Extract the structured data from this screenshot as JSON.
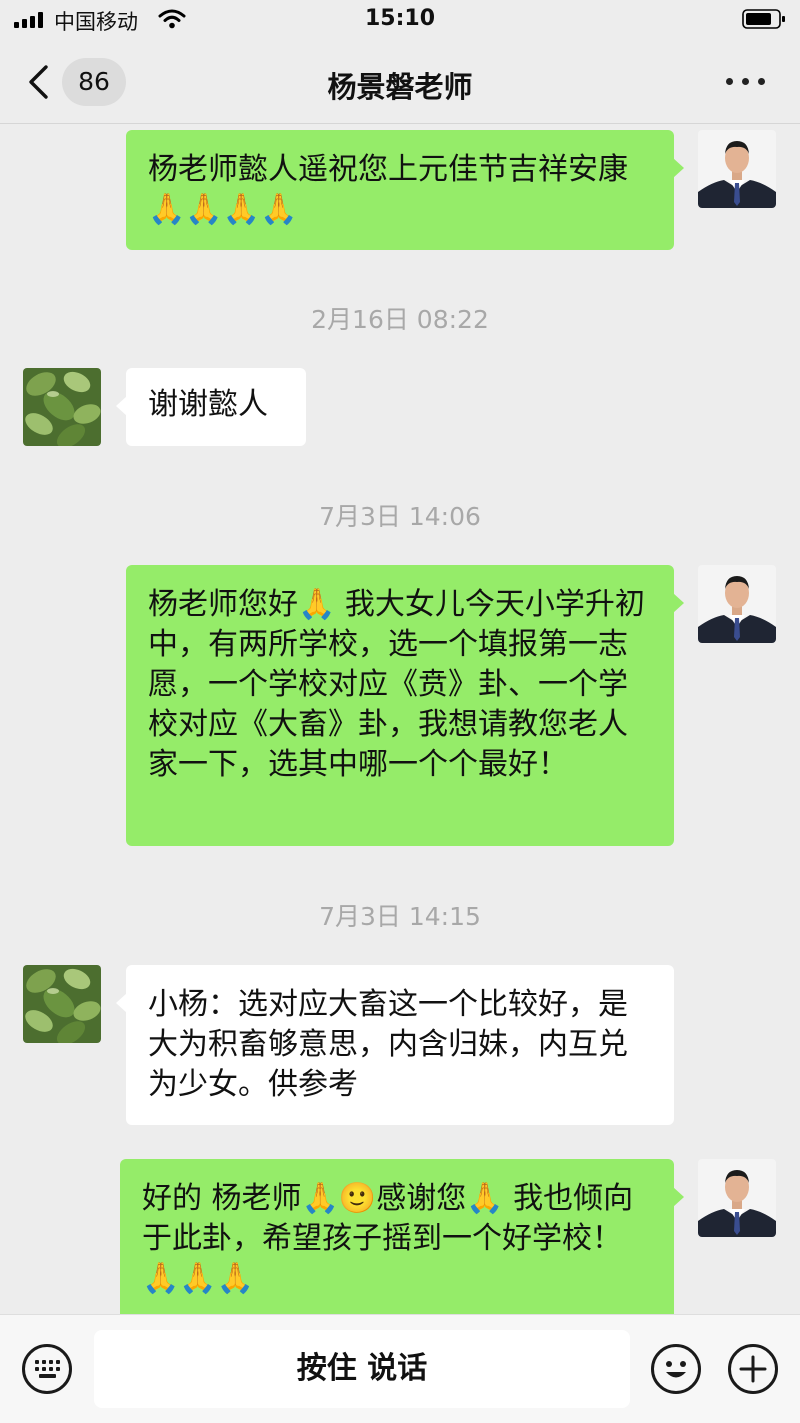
{
  "status_bar": {
    "carrier": "中国移动",
    "time": "15:10",
    "icons": [
      "signal-icon",
      "wifi-icon",
      "battery-icon"
    ]
  },
  "nav": {
    "unread_count": "86",
    "title": "杨景磐老师",
    "icons": [
      "back-chevron-icon",
      "more-icon"
    ]
  },
  "messages": [
    {
      "side": "sent",
      "text": "杨老师懿人遥祝您上元佳节吉祥安康🙏🙏🙏🙏"
    },
    {
      "timestamp": "2月16日 08:22"
    },
    {
      "side": "received",
      "text": "谢谢懿人"
    },
    {
      "timestamp": "7月3日 14:06"
    },
    {
      "side": "sent",
      "text": " 杨老师您好🙏 我大女儿今天小学升初中，有两所学校，选一个填报第一志愿，一个学校对应《贲》卦、一个学校对应《大畜》卦，我想请教您老人家一下，选其中哪一个个最好！"
    },
    {
      "timestamp": "7月3日 14:15"
    },
    {
      "side": "received",
      "text": "小杨：选对应大畜这一个比较好，是大为积畜够意思，内含归妹，内互兑为少女。供参考"
    },
    {
      "side": "sent",
      "text": "好的 杨老师🙏🙂感谢您🙏 我也倾向于此卦，希望孩子摇到一个好学校！🙏🙏🙏"
    }
  ],
  "input_bar": {
    "hold_to_talk": "按住 说话",
    "icons": [
      "keyboard-icon",
      "emoji-icon",
      "plus-icon"
    ]
  },
  "colors": {
    "background": "#ededed",
    "sent_bubble": "#95ec69",
    "received_bubble": "#ffffff",
    "timestamp_text": "#a8a8a8"
  }
}
